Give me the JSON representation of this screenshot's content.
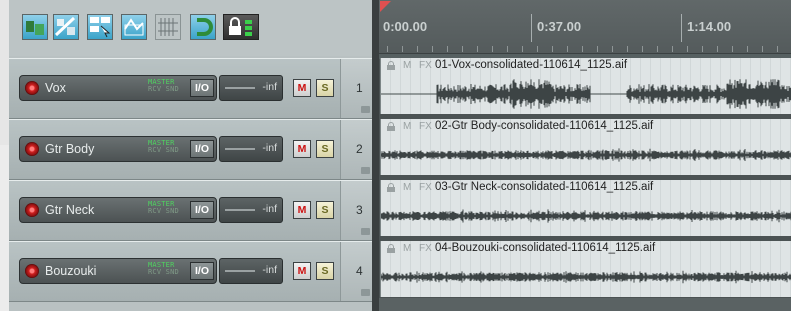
{
  "toolbar": {
    "buttons": [
      {
        "name": "auto-crossfade-icon"
      },
      {
        "name": "ripple-edit-icon"
      },
      {
        "name": "grouping-icon"
      },
      {
        "name": "envelope-points-icon"
      },
      {
        "name": "grid-icon"
      },
      {
        "name": "snap-icon"
      },
      {
        "name": "lock-icon"
      }
    ]
  },
  "ruler": {
    "labels": [
      "0:00.00",
      "0:37.00",
      "1:14.00"
    ]
  },
  "tracks": [
    {
      "number": "1",
      "name": "Vox",
      "master": "MASTER",
      "rcv": "RCV SND",
      "io": "I/O",
      "volume": "-inf",
      "mute": "M",
      "solo": "S",
      "item": {
        "m": "M",
        "fx": "FX",
        "filename": "01-Vox-consolidated-110614_1125.aif"
      }
    },
    {
      "number": "2",
      "name": "Gtr Body",
      "master": "MASTER",
      "rcv": "RCV SND",
      "io": "I/O",
      "volume": "-inf",
      "mute": "M",
      "solo": "S",
      "item": {
        "m": "M",
        "fx": "FX",
        "filename": "02-Gtr Body-consolidated-110614_1125.aif"
      }
    },
    {
      "number": "3",
      "name": "Gtr Neck",
      "master": "MASTER",
      "rcv": "RCV SND",
      "io": "I/O",
      "volume": "-inf",
      "mute": "M",
      "solo": "S",
      "item": {
        "m": "M",
        "fx": "FX",
        "filename": "03-Gtr Neck-consolidated-110614_1125.aif"
      }
    },
    {
      "number": "4",
      "name": "Bouzouki",
      "master": "MASTER",
      "rcv": "RCV SND",
      "io": "I/O",
      "volume": "-inf",
      "mute": "M",
      "solo": "S",
      "item": {
        "m": "M",
        "fx": "FX",
        "filename": "04-Bouzouki-consolidated-110614_1125.aif"
      }
    }
  ],
  "colors": {
    "accent": "#3aa3c9",
    "record": "#d02020",
    "mute": "#cc1111",
    "master_text": "#4fd260"
  }
}
